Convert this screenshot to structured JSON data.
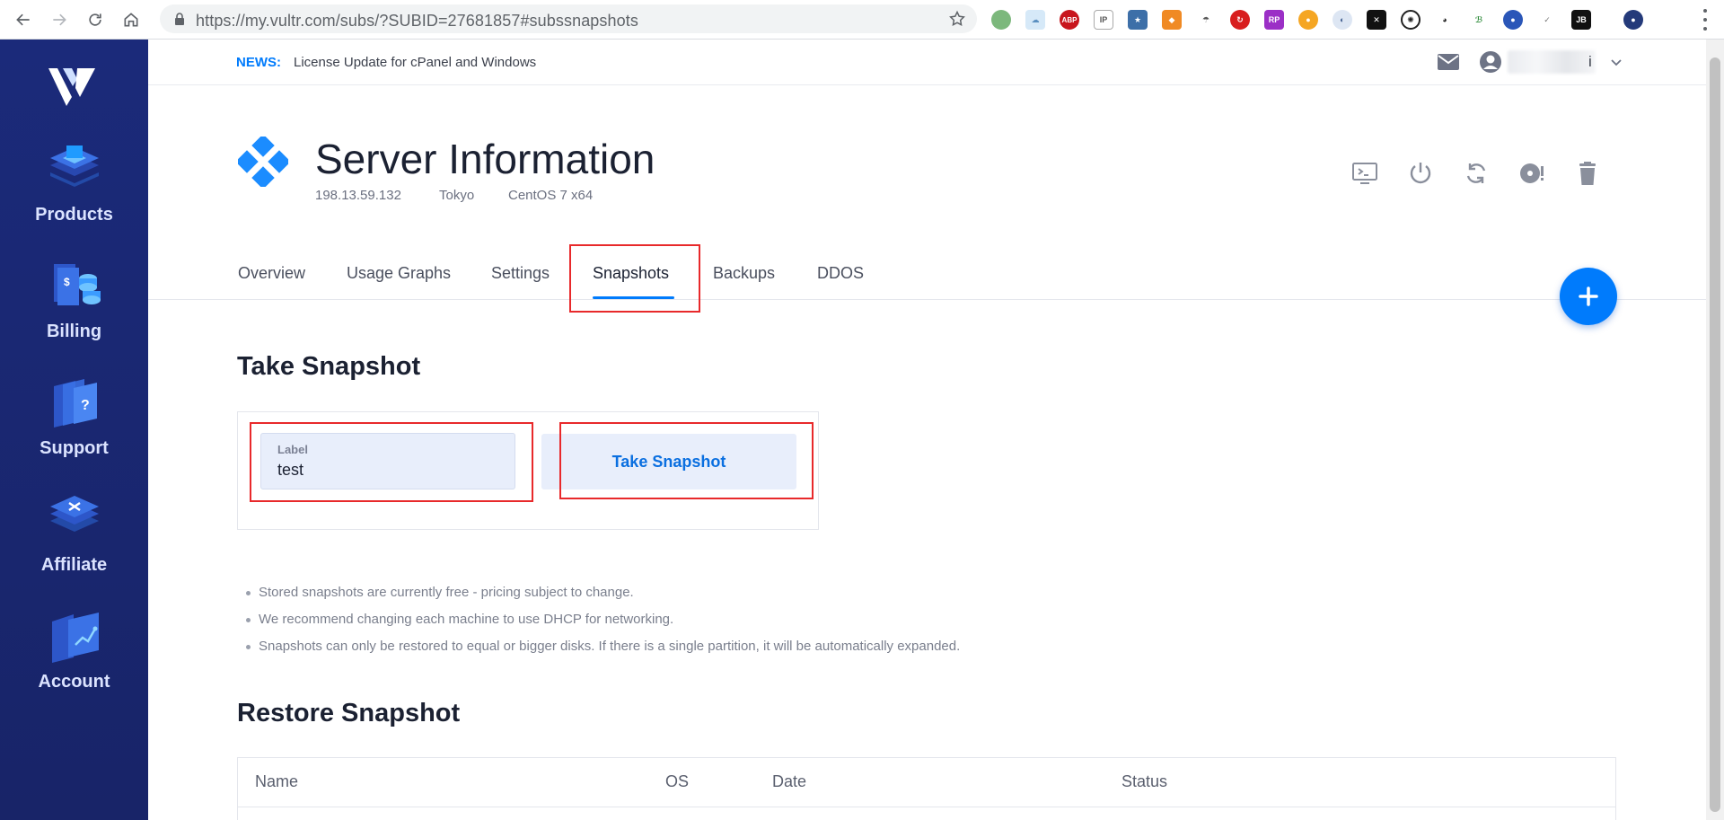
{
  "browser": {
    "url": "https://my.vultr.com/subs/?SUBID=27681857#subssnapshots"
  },
  "sidebar": {
    "items": [
      {
        "label": "Products",
        "icon": "products-icon"
      },
      {
        "label": "Billing",
        "icon": "billing-icon"
      },
      {
        "label": "Support",
        "icon": "support-icon"
      },
      {
        "label": "Affiliate",
        "icon": "affiliate-icon"
      },
      {
        "label": "Account",
        "icon": "account-icon"
      }
    ]
  },
  "news": {
    "tag": "NEWS:",
    "text": "License Update for cPanel and Windows"
  },
  "user": {
    "name_tail": "i"
  },
  "server": {
    "title": "Server Information",
    "ip": "198.13.59.132",
    "location": "Tokyo",
    "os": "CentOS 7 x64"
  },
  "tabs": [
    {
      "label": "Overview"
    },
    {
      "label": "Usage Graphs"
    },
    {
      "label": "Settings"
    },
    {
      "label": "Snapshots",
      "active": true
    },
    {
      "label": "Backups"
    },
    {
      "label": "DDOS"
    }
  ],
  "take_snapshot": {
    "title": "Take Snapshot",
    "label_caption": "Label",
    "label_value": "test",
    "button_label": "Take Snapshot"
  },
  "notes": [
    "Stored snapshots are currently free - pricing subject to change.",
    "We recommend changing each machine to use DHCP for networking.",
    "Snapshots can only be restored to equal or bigger disks. If there is a single partition, it will be automatically expanded."
  ],
  "restore_snapshot": {
    "title": "Restore Snapshot",
    "columns": [
      "Name",
      "OS",
      "Date",
      "Status"
    ]
  },
  "colors": {
    "sidebar": "#1b2a7a",
    "accent": "#007bfc",
    "highlight": "#e8292b"
  }
}
